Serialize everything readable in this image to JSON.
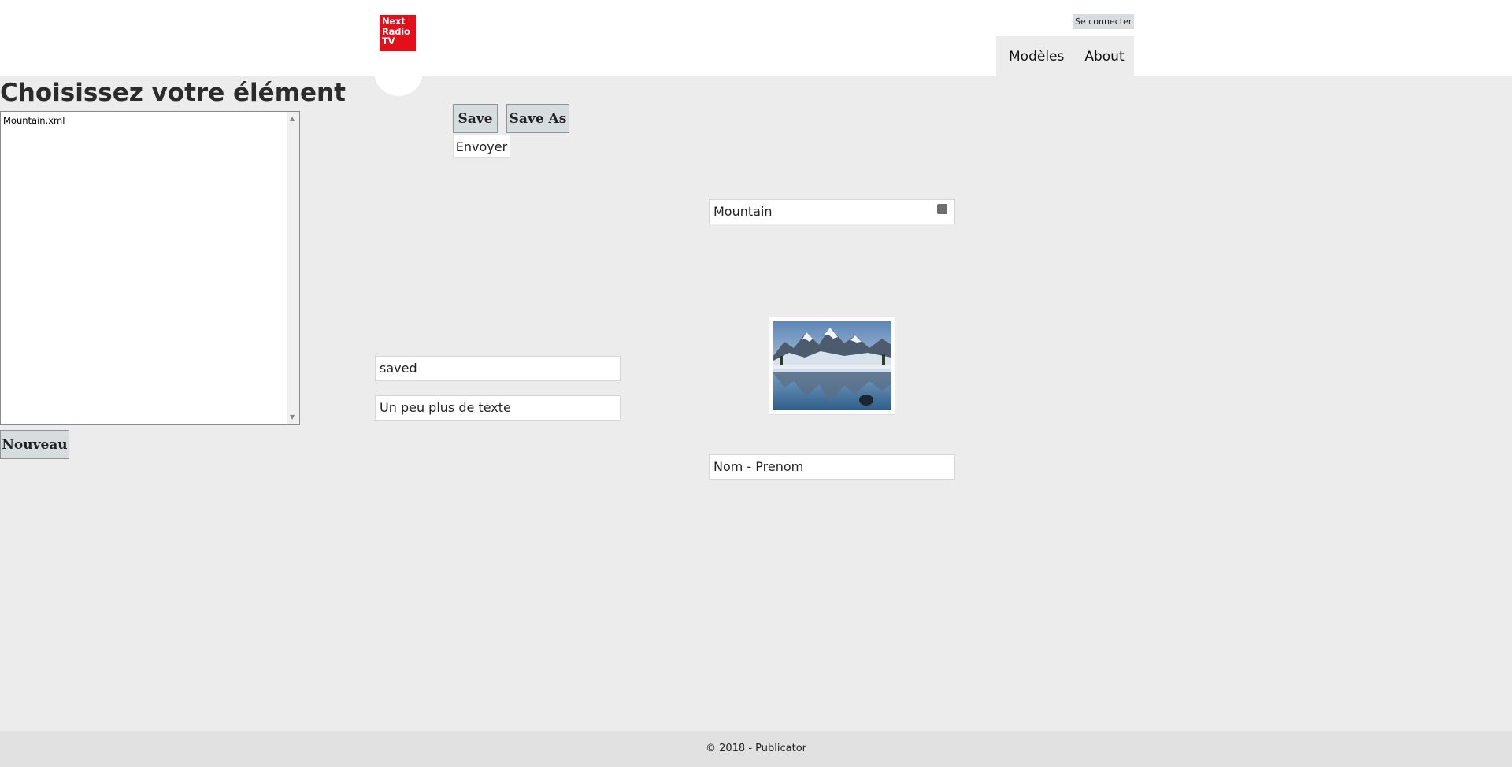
{
  "header": {
    "logo_text": "Next Radio TV",
    "login_label": "Se connecter",
    "nav": [
      "Modèles",
      "About"
    ]
  },
  "sidebar": {
    "title": "Choisissez votre élément",
    "files": [
      "Mountain.xml"
    ],
    "new_label": "Nouveau"
  },
  "toolbar": {
    "save_label": "Save",
    "save_as_label": "Save As",
    "send_label": "Envoyer"
  },
  "form": {
    "title_value": "Mountain",
    "status_value": "saved",
    "text_value": "Un peu plus de texte",
    "name_value": "Nom - Prenom",
    "image_icon": "mountain-lake-image",
    "keyboard_icon": "keyboard-icon"
  },
  "footer": {
    "copyright": "© 2018 - Publicator"
  },
  "colors": {
    "brand_red": "#e3101b",
    "background": "#ececec",
    "button_gray": "#d7dcdf"
  }
}
